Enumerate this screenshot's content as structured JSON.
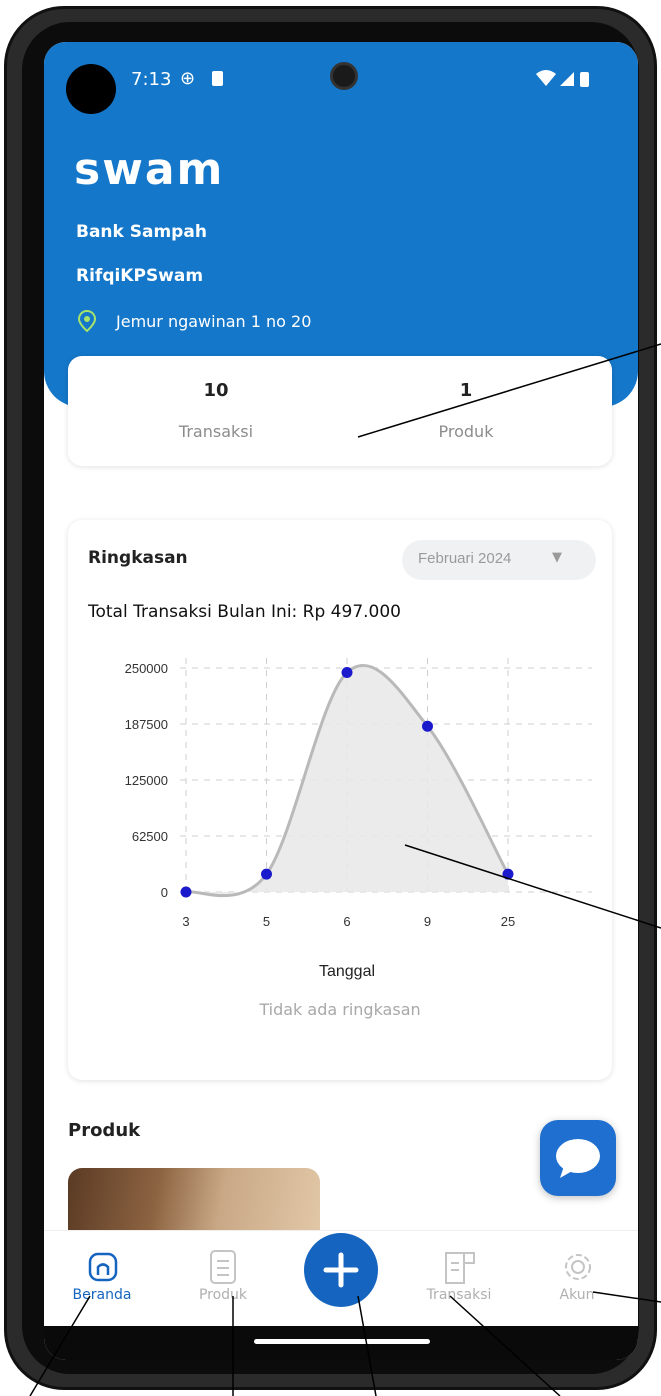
{
  "status_bar": {
    "time": "7:13"
  },
  "header": {
    "logo": "swam",
    "org_type": "Bank Sampah",
    "org_name": "RifqiKPSwam",
    "address": "Jemur ngawinan 1 no 20"
  },
  "stats": [
    {
      "value": "10",
      "label": "Transaksi"
    },
    {
      "value": "1",
      "label": "Produk"
    }
  ],
  "summary": {
    "title": "Ringkasan",
    "month_selector": "Februari 2024",
    "total_text": "Total Transaksi Bulan Ini: Rp 497.000",
    "empty_text": "Tidak ada ringkasan"
  },
  "chart_data": {
    "type": "area",
    "categories": [
      "3",
      "5",
      "6",
      "9",
      "25"
    ],
    "values": [
      0,
      20000,
      245000,
      185000,
      20000
    ],
    "xlabel": "Tanggal",
    "ylabel": "",
    "yticks": [
      "250000",
      "187500",
      "125000",
      "62500",
      "0"
    ],
    "ylim": [
      0,
      250000
    ],
    "grid": true,
    "colors": {
      "line": "#b9b9b9",
      "fill": "#e8e8e8",
      "point": "#1a1acc"
    }
  },
  "products_section": {
    "title": "Produk"
  },
  "bottom_nav": {
    "items": [
      {
        "label": "Beranda",
        "icon": "home-icon",
        "active": true
      },
      {
        "label": "Produk",
        "icon": "document-icon",
        "active": false
      },
      {
        "label": "Transaksi",
        "icon": "receipt-icon",
        "active": false
      },
      {
        "label": "Akun",
        "icon": "gear-icon",
        "active": false
      }
    ]
  },
  "colors": {
    "brand": "#1577c9",
    "accent_blue": "#1565c0"
  }
}
